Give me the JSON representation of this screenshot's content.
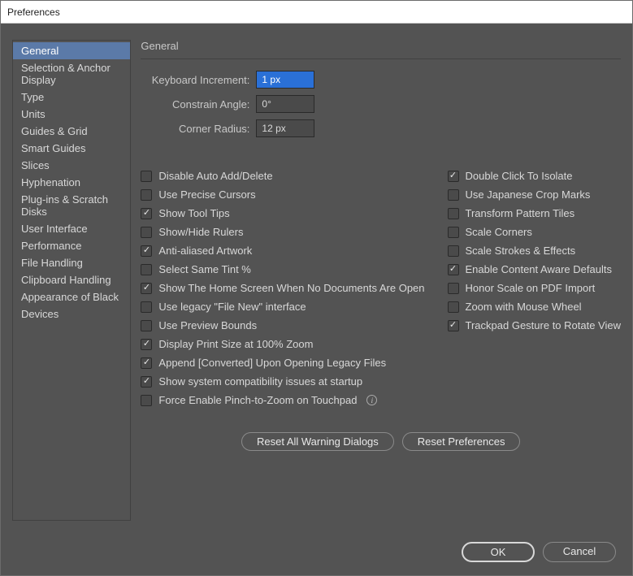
{
  "window": {
    "title": "Preferences"
  },
  "sidebar": {
    "items": [
      "General",
      "Selection & Anchor Display",
      "Type",
      "Units",
      "Guides & Grid",
      "Smart Guides",
      "Slices",
      "Hyphenation",
      "Plug-ins & Scratch Disks",
      "User Interface",
      "Performance",
      "File Handling",
      "Clipboard Handling",
      "Appearance of Black",
      "Devices"
    ],
    "selected": 0
  },
  "section": {
    "title": "General",
    "fields": {
      "keyboard_increment": {
        "label": "Keyboard Increment:",
        "value": "1 px"
      },
      "constrain_angle": {
        "label": "Constrain Angle:",
        "value": "0°"
      },
      "corner_radius": {
        "label": "Corner Radius:",
        "value": "12 px"
      }
    }
  },
  "checks": {
    "left": [
      {
        "label": "Disable Auto Add/Delete",
        "checked": false
      },
      {
        "label": "Use Precise Cursors",
        "checked": false
      },
      {
        "label": "Show Tool Tips",
        "checked": true
      },
      {
        "label": "Show/Hide Rulers",
        "checked": false
      },
      {
        "label": "Anti-aliased Artwork",
        "checked": true
      },
      {
        "label": "Select Same Tint %",
        "checked": false
      },
      {
        "label": "Show The Home Screen When No Documents Are Open",
        "checked": true
      },
      {
        "label": "Use legacy \"File New\" interface",
        "checked": false
      },
      {
        "label": "Use Preview Bounds",
        "checked": false
      },
      {
        "label": "Display Print Size at 100% Zoom",
        "checked": true
      },
      {
        "label": "Append [Converted] Upon Opening Legacy Files",
        "checked": true
      },
      {
        "label": "Show system compatibility issues at startup",
        "checked": true
      },
      {
        "label": "Force Enable Pinch-to-Zoom on Touchpad",
        "checked": false,
        "info": true
      }
    ],
    "right": [
      {
        "label": "Double Click To Isolate",
        "checked": true
      },
      {
        "label": "Use Japanese Crop Marks",
        "checked": false
      },
      {
        "label": "Transform Pattern Tiles",
        "checked": false
      },
      {
        "label": "Scale Corners",
        "checked": false
      },
      {
        "label": "Scale Strokes & Effects",
        "checked": false
      },
      {
        "label": "Enable Content Aware Defaults",
        "checked": true
      },
      {
        "label": "Honor Scale on PDF Import",
        "checked": false
      },
      {
        "label": "Zoom with Mouse Wheel",
        "checked": false
      },
      {
        "label": "Trackpad Gesture to Rotate View",
        "checked": true
      }
    ]
  },
  "buttons": {
    "reset_warnings": "Reset All Warning Dialogs",
    "reset_prefs": "Reset Preferences",
    "ok": "OK",
    "cancel": "Cancel"
  }
}
